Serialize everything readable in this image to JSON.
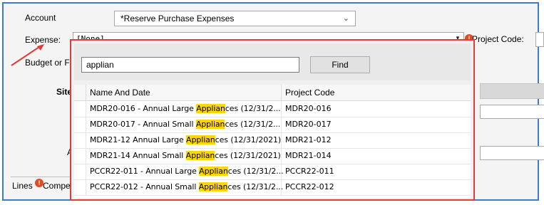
{
  "form": {
    "account_label": "Account",
    "account_value": "*Reserve Purchase Expenses",
    "expense_label": "Expense:",
    "expense_value": "[None]",
    "project_code_label": "Project Code:",
    "budget_label": "Budget or F",
    "site_label": "Site/",
    "a_label": "A",
    "lines_tab": "Lines",
    "compe_tab": "Compe"
  },
  "lookup": {
    "search_value": "applian",
    "find_label": "Find",
    "columns": [
      "Name And Date",
      "Project Code"
    ],
    "rows": [
      {
        "pre": "MDR20-016 - Annual Large ",
        "hit": "Applian",
        "post": "ces (12/31/2...",
        "code": "MDR20-016"
      },
      {
        "pre": "MDR20-017 - Annual Small ",
        "hit": "Applian",
        "post": "ces (12/31/2...",
        "code": "MDR20-017"
      },
      {
        "pre": "MDR21-12  Annual Large ",
        "hit": "Applian",
        "post": "ces (12/31/2021)",
        "code": "MDR21-012"
      },
      {
        "pre": "MDR21-14  Annual Small ",
        "hit": "Applian",
        "post": "ces (12/31/2021)",
        "code": "MDR21-014"
      },
      {
        "pre": "PCCR22-011 - Annual Large ",
        "hit": "Applian",
        "post": "ces (12/31/2...",
        "code": "PCCR22-011"
      },
      {
        "pre": "PCCR22-012 - Annual Small ",
        "hit": "Applian",
        "post": "ces (12/31/2...",
        "code": "PCCR22-012"
      }
    ]
  },
  "icons": {
    "warning": "warning-icon",
    "dropdown": "chevron-down-icon",
    "annotation": "red-arrow"
  },
  "colors": {
    "frame_border": "#3b7bd4",
    "popup_border": "#e23b3b",
    "highlight": "#ffd700",
    "warning": "#e24a1f"
  }
}
